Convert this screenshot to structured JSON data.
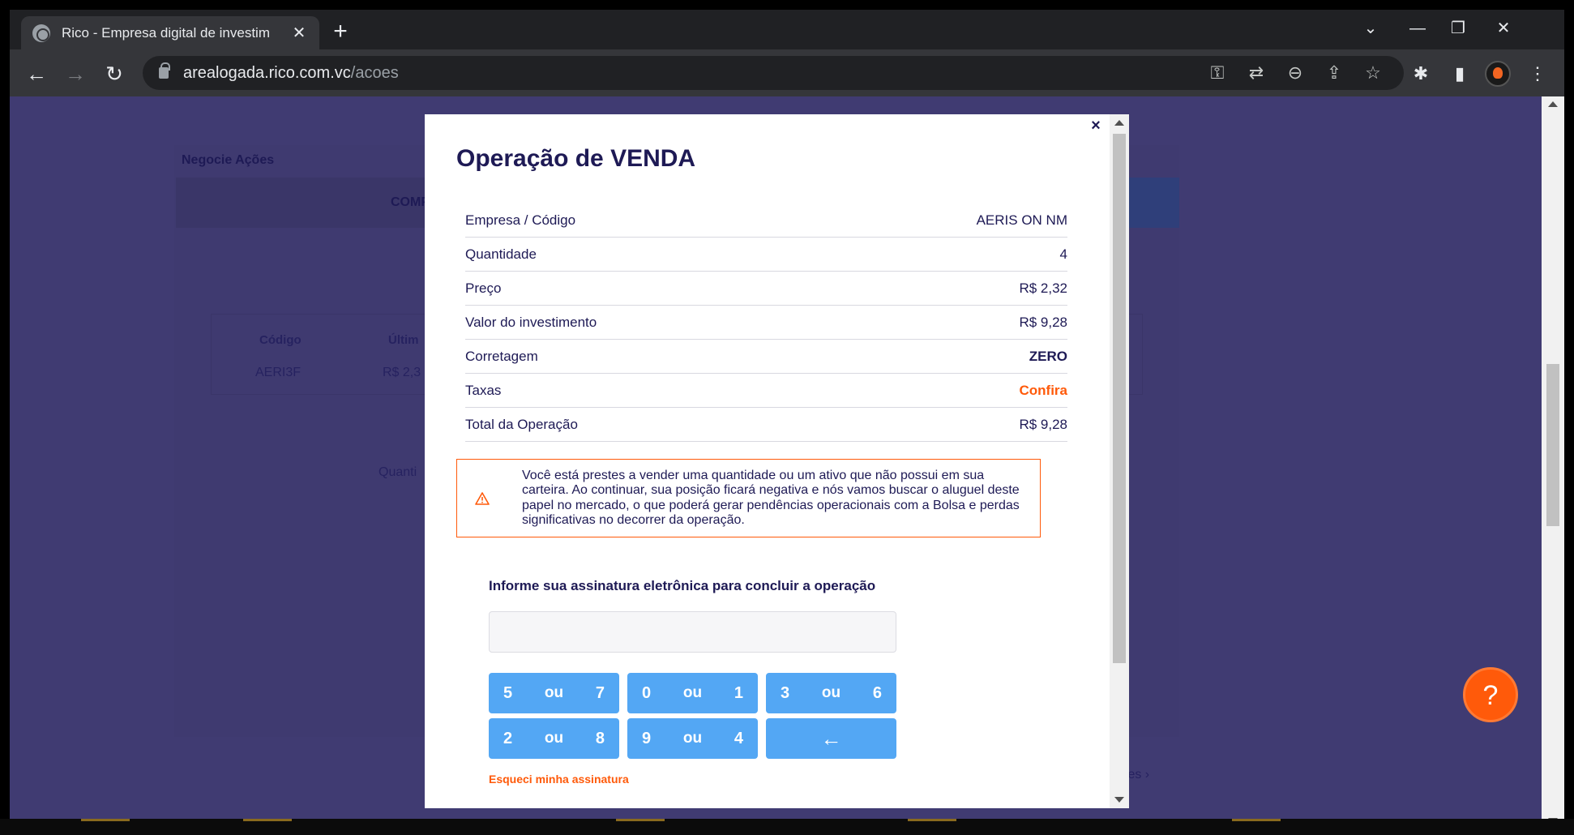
{
  "browser": {
    "tab_title": "Rico - Empresa digital de investim",
    "url_host": "arealogada.rico.com.vc",
    "url_path": "/acoes"
  },
  "background": {
    "section_title": "Negocie Ações",
    "tab_compra": "COMP",
    "table_headers": [
      "Código",
      "Últim"
    ],
    "table_values": [
      "AERI3F",
      "R$ 2,3"
    ],
    "qty_label": "Quanti",
    "link_text": "tes ›"
  },
  "modal": {
    "title": "Operação de VENDA",
    "rows": [
      {
        "label": "Empresa / Código",
        "value": "AERIS ON NM"
      },
      {
        "label": "Quantidade",
        "value": "4"
      },
      {
        "label": "Preço",
        "value": "R$ 2,32"
      },
      {
        "label": "Valor do investimento",
        "value": "R$ 9,28"
      },
      {
        "label": "Corretagem",
        "value": "ZERO"
      },
      {
        "label": "Taxas",
        "value": "Confira"
      },
      {
        "label": "Total da Operação",
        "value": "R$ 9,28"
      }
    ],
    "warning": "Você está prestes a vender uma quantidade ou um ativo que não possui em sua carteira. Ao continuar, sua posição ficará negativa e nós vamos buscar o aluguel deste papel no mercado, o que poderá gerar pendências operacionais com a Bolsa e perdas significativas no decorrer da operação.",
    "signature_label": "Informe sua assinatura eletrônica para concluir a operação",
    "keys": [
      {
        "a": "5",
        "b": "7"
      },
      {
        "a": "0",
        "b": "1"
      },
      {
        "a": "3",
        "b": "6"
      },
      {
        "a": "2",
        "b": "8"
      },
      {
        "a": "9",
        "b": "4"
      }
    ],
    "or_word": "ou",
    "forgot_link": "Esqueci minha assinatura"
  },
  "colors": {
    "accent": "#ff5a0a",
    "key_blue": "#53a7f4",
    "text_dark": "#1e1a55",
    "page_bg": "#403b72"
  }
}
